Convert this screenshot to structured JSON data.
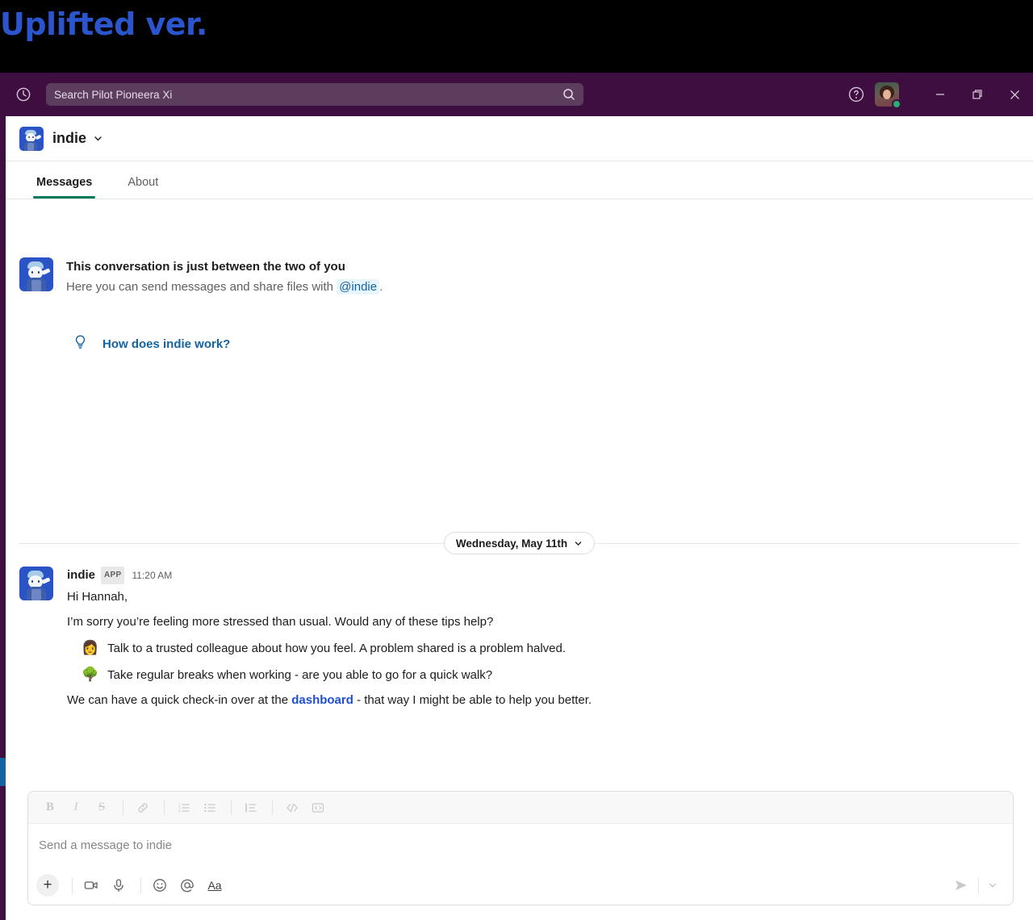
{
  "banner": {
    "text": "Uplifted ver."
  },
  "titlebar": {
    "history_icon": "clock-icon",
    "help_icon": "help-circle-icon",
    "search_placeholder": "Search Pilot Pioneera Xi",
    "search_icon": "search-icon",
    "minimize_label": "–",
    "maximize_label": "❐",
    "close_label": "✕",
    "presence_color": "#2bac76",
    "background_color": "#3f0e40"
  },
  "channel": {
    "name": "indie",
    "chevron_icon": "chevron-down-icon",
    "avatar_icon": "indie-bot-avatar"
  },
  "tabs": [
    {
      "label": "Messages",
      "active": true
    },
    {
      "label": "About",
      "active": false
    }
  ],
  "intro": {
    "title": "This conversation is just between the two of you",
    "subtitle_before": "Here you can send messages and share files with",
    "mention": "@indie",
    "subtitle_after": ".",
    "hint_icon": "lightbulb-icon",
    "hint_label": "How does indie work?"
  },
  "date_divider": {
    "label": "Wednesday, May 11th",
    "chevron_icon": "chevron-down-icon"
  },
  "message": {
    "author": "indie",
    "badge": "APP",
    "time": "11:20 AM",
    "greeting": "Hi Hannah,",
    "intro_line": "I’m sorry you’re feeling more stressed than usual. Would any of these tips help?",
    "tips": [
      {
        "emoji": "👩",
        "emoji_name": "person-emoji",
        "text": "Talk to a trusted colleague about how you feel. A problem shared is a problem halved."
      },
      {
        "emoji": "🌳",
        "emoji_name": "tree-emoji",
        "text": "Take regular breaks when working - are you able to go for a quick walk?"
      }
    ],
    "closing_before": "We can have a quick check-in over at the",
    "closing_link": "dashboard",
    "closing_after": "- that way I might be able to help you better.",
    "link_color": "#1d4ed8"
  },
  "composer": {
    "placeholder": "Send a message to indie",
    "format_buttons": [
      {
        "name": "bold-icon",
        "glyph": "B"
      },
      {
        "name": "italic-icon",
        "glyph": "I"
      },
      {
        "name": "strikethrough-icon",
        "glyph": "S"
      },
      {
        "name": "link-icon",
        "glyph": "🔗"
      },
      {
        "name": "ordered-list-icon",
        "glyph": ""
      },
      {
        "name": "bulleted-list-icon",
        "glyph": ""
      },
      {
        "name": "blockquote-icon",
        "glyph": ""
      },
      {
        "name": "code-icon",
        "glyph": "</>"
      },
      {
        "name": "code-block-icon",
        "glyph": ""
      }
    ],
    "action_buttons": [
      {
        "name": "add-attachment-button",
        "glyph": "+"
      },
      {
        "name": "video-clip-icon",
        "glyph": ""
      },
      {
        "name": "audio-clip-icon",
        "glyph": ""
      },
      {
        "name": "emoji-icon",
        "glyph": ""
      },
      {
        "name": "mention-icon",
        "glyph": "@"
      },
      {
        "name": "formatting-icon",
        "glyph": "Aa"
      }
    ],
    "send_icon": "send-icon",
    "send_options_icon": "chevron-down-icon"
  },
  "colors": {
    "slack_purple": "#3f0e40",
    "active_tab_underline": "#007a5a",
    "link_blue": "#1264a3",
    "accent_blue": "#1264a3"
  }
}
